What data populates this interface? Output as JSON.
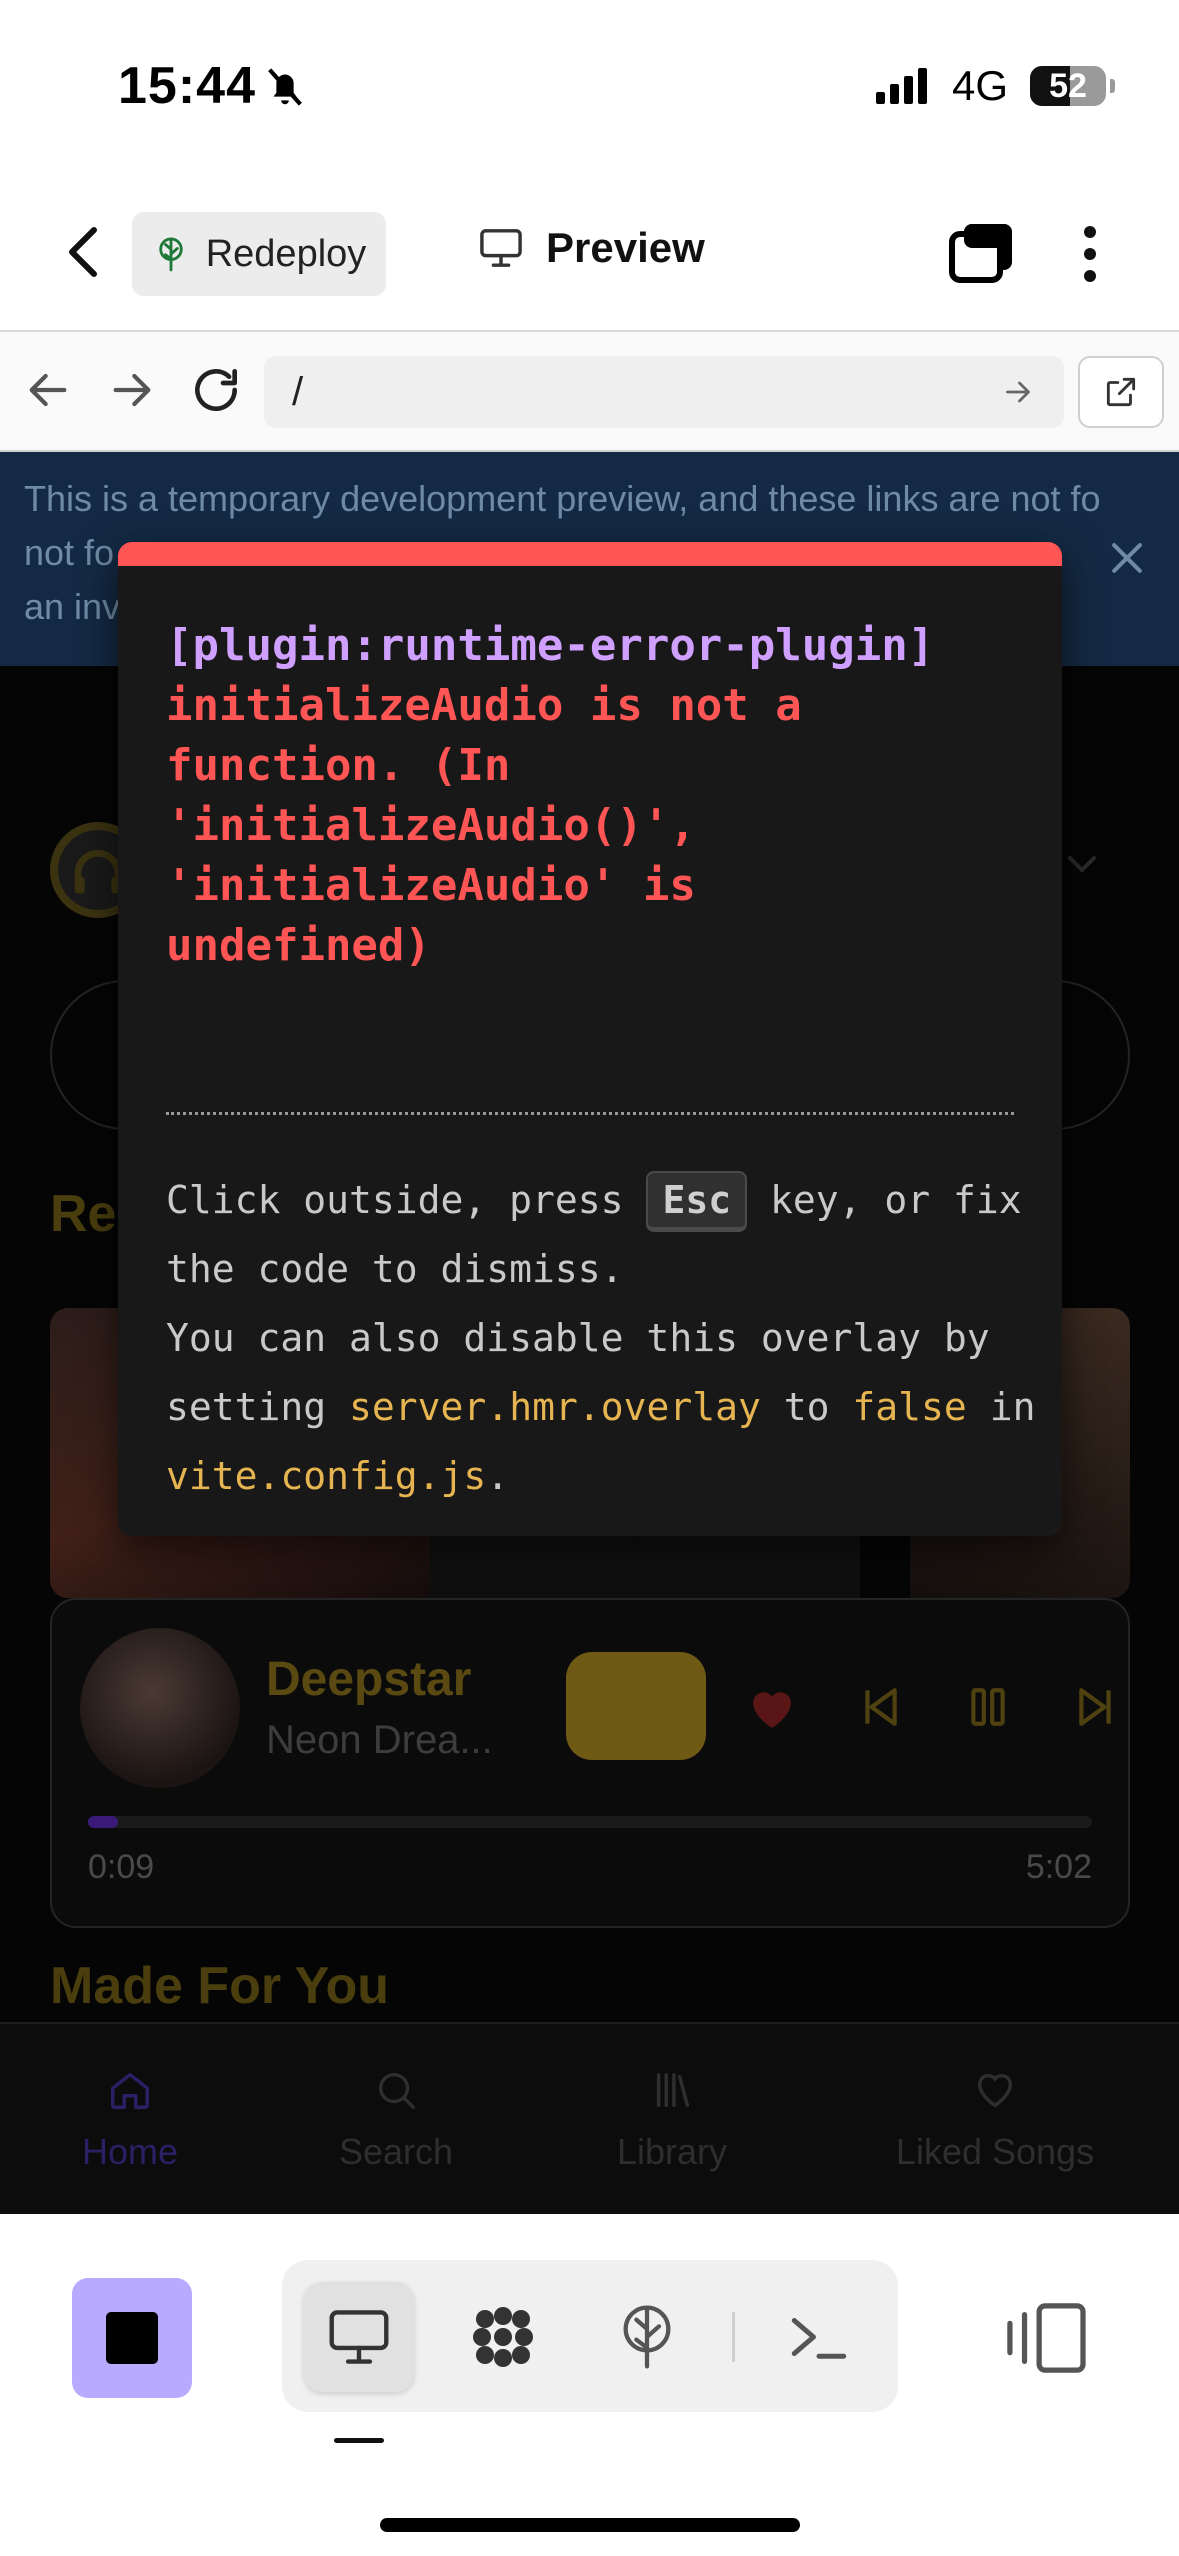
{
  "status_bar": {
    "time": "15:44",
    "carrier": "4G",
    "battery_level": "52",
    "battery_fraction": 0.52
  },
  "header": {
    "redeploy_label": "Redeploy",
    "preview_label": "Preview"
  },
  "browser": {
    "url": "/"
  },
  "page": {
    "banner_text": "This is a temporary development preview, and these links are not fo",
    "banner_line2": "not fo",
    "banner_line3": "an inv",
    "recent_heading": "Re",
    "made_for_you_heading": "Made For You",
    "player": {
      "title": "Deepstar",
      "artist": "Neon Drea...",
      "current_time": "0:09",
      "total_time": "5:02",
      "progress_fraction": 0.03
    },
    "tabs": [
      {
        "label": "Home",
        "icon": "home-icon",
        "active": true
      },
      {
        "label": "Search",
        "icon": "search-icon",
        "active": false
      },
      {
        "label": "Library",
        "icon": "library-icon",
        "active": false
      },
      {
        "label": "Liked Songs",
        "icon": "heart-icon",
        "active": false
      }
    ]
  },
  "error_overlay": {
    "plugin": "[plugin:runtime-error-plugin]",
    "message": "initializeAudio is not a\nfunction. (In\n'initializeAudio()',\n'initializeAudio' is\nundefined)",
    "tip_part1": "Click outside, press",
    "tip_key": "Esc",
    "tip_part2": "key, or fix the code to dismiss.",
    "tip_part3": "You can also disable this overlay by setting",
    "tip_config_key": "server.hmr.overlay",
    "tip_part4": "to",
    "tip_false": "false",
    "tip_part5": "in",
    "tip_file": "vite.config.js",
    "tip_end": "."
  },
  "colors": {
    "accent": "#b8aaff",
    "error": "#ff5555",
    "plugin": "#cfa0ff",
    "highlight": "#e6b450"
  }
}
